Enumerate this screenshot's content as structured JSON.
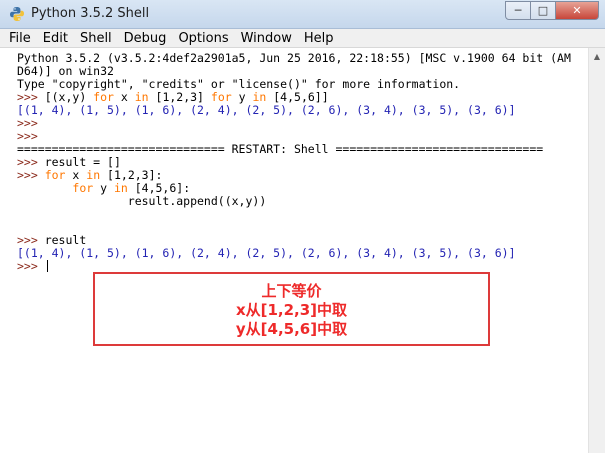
{
  "window": {
    "title": "Python 3.5.2 Shell",
    "minimize": "─",
    "maximize": "□",
    "close": "✕"
  },
  "menu": [
    "File",
    "Edit",
    "Shell",
    "Debug",
    "Options",
    "Window",
    "Help"
  ],
  "shell": {
    "banner1": "Python 3.5.2 (v3.5.2:4def2a2901a5, Jun 25 2016, 22:18:55) [MSC v.1900 64 bit (AM",
    "banner2": "D64)] on win32",
    "banner3": "Type \"copyright\", \"credits\" or \"license()\" for more information.",
    "prompt": ">>> ",
    "l1_a": "[(x,y) ",
    "l1_for1": "for",
    "l1_b": " x ",
    "l1_in1": "in",
    "l1_c": " [1,2,3] ",
    "l1_for2": "for",
    "l1_d": " y ",
    "l1_in2": "in",
    "l1_e": " [4,5,6]]",
    "result_list": "[(1, 4), (1, 5), (1, 6), (2, 4), (2, 5), (2, 6), (3, 4), (3, 5), (3, 6)]",
    "restart": "============================== RESTART: Shell ==============================",
    "assign": "result = []",
    "loop1_for": "for",
    "loop1_b": " x ",
    "loop1_in": "in",
    "loop1_c": " [1,2,3]:",
    "loop2_indent": "        ",
    "loop2_for": "for",
    "loop2_b": " y ",
    "loop2_in": "in",
    "loop2_c": " [4,5,6]:",
    "append_line": "                result.append((x,y))",
    "result_cmd": "result",
    "result_list2": "[(1, 4), (1, 5), (1, 6), (2, 4), (2, 5), (2, 6), (3, 4), (3, 5), (3, 6)]"
  },
  "annotation": {
    "line1": "上下等价",
    "line2": "x从[1,2,3]中取",
    "line3": "y从[4,5,6]中取",
    "color": "#ee2a2a"
  },
  "scrollbar": {
    "up_arrow": "▲"
  }
}
